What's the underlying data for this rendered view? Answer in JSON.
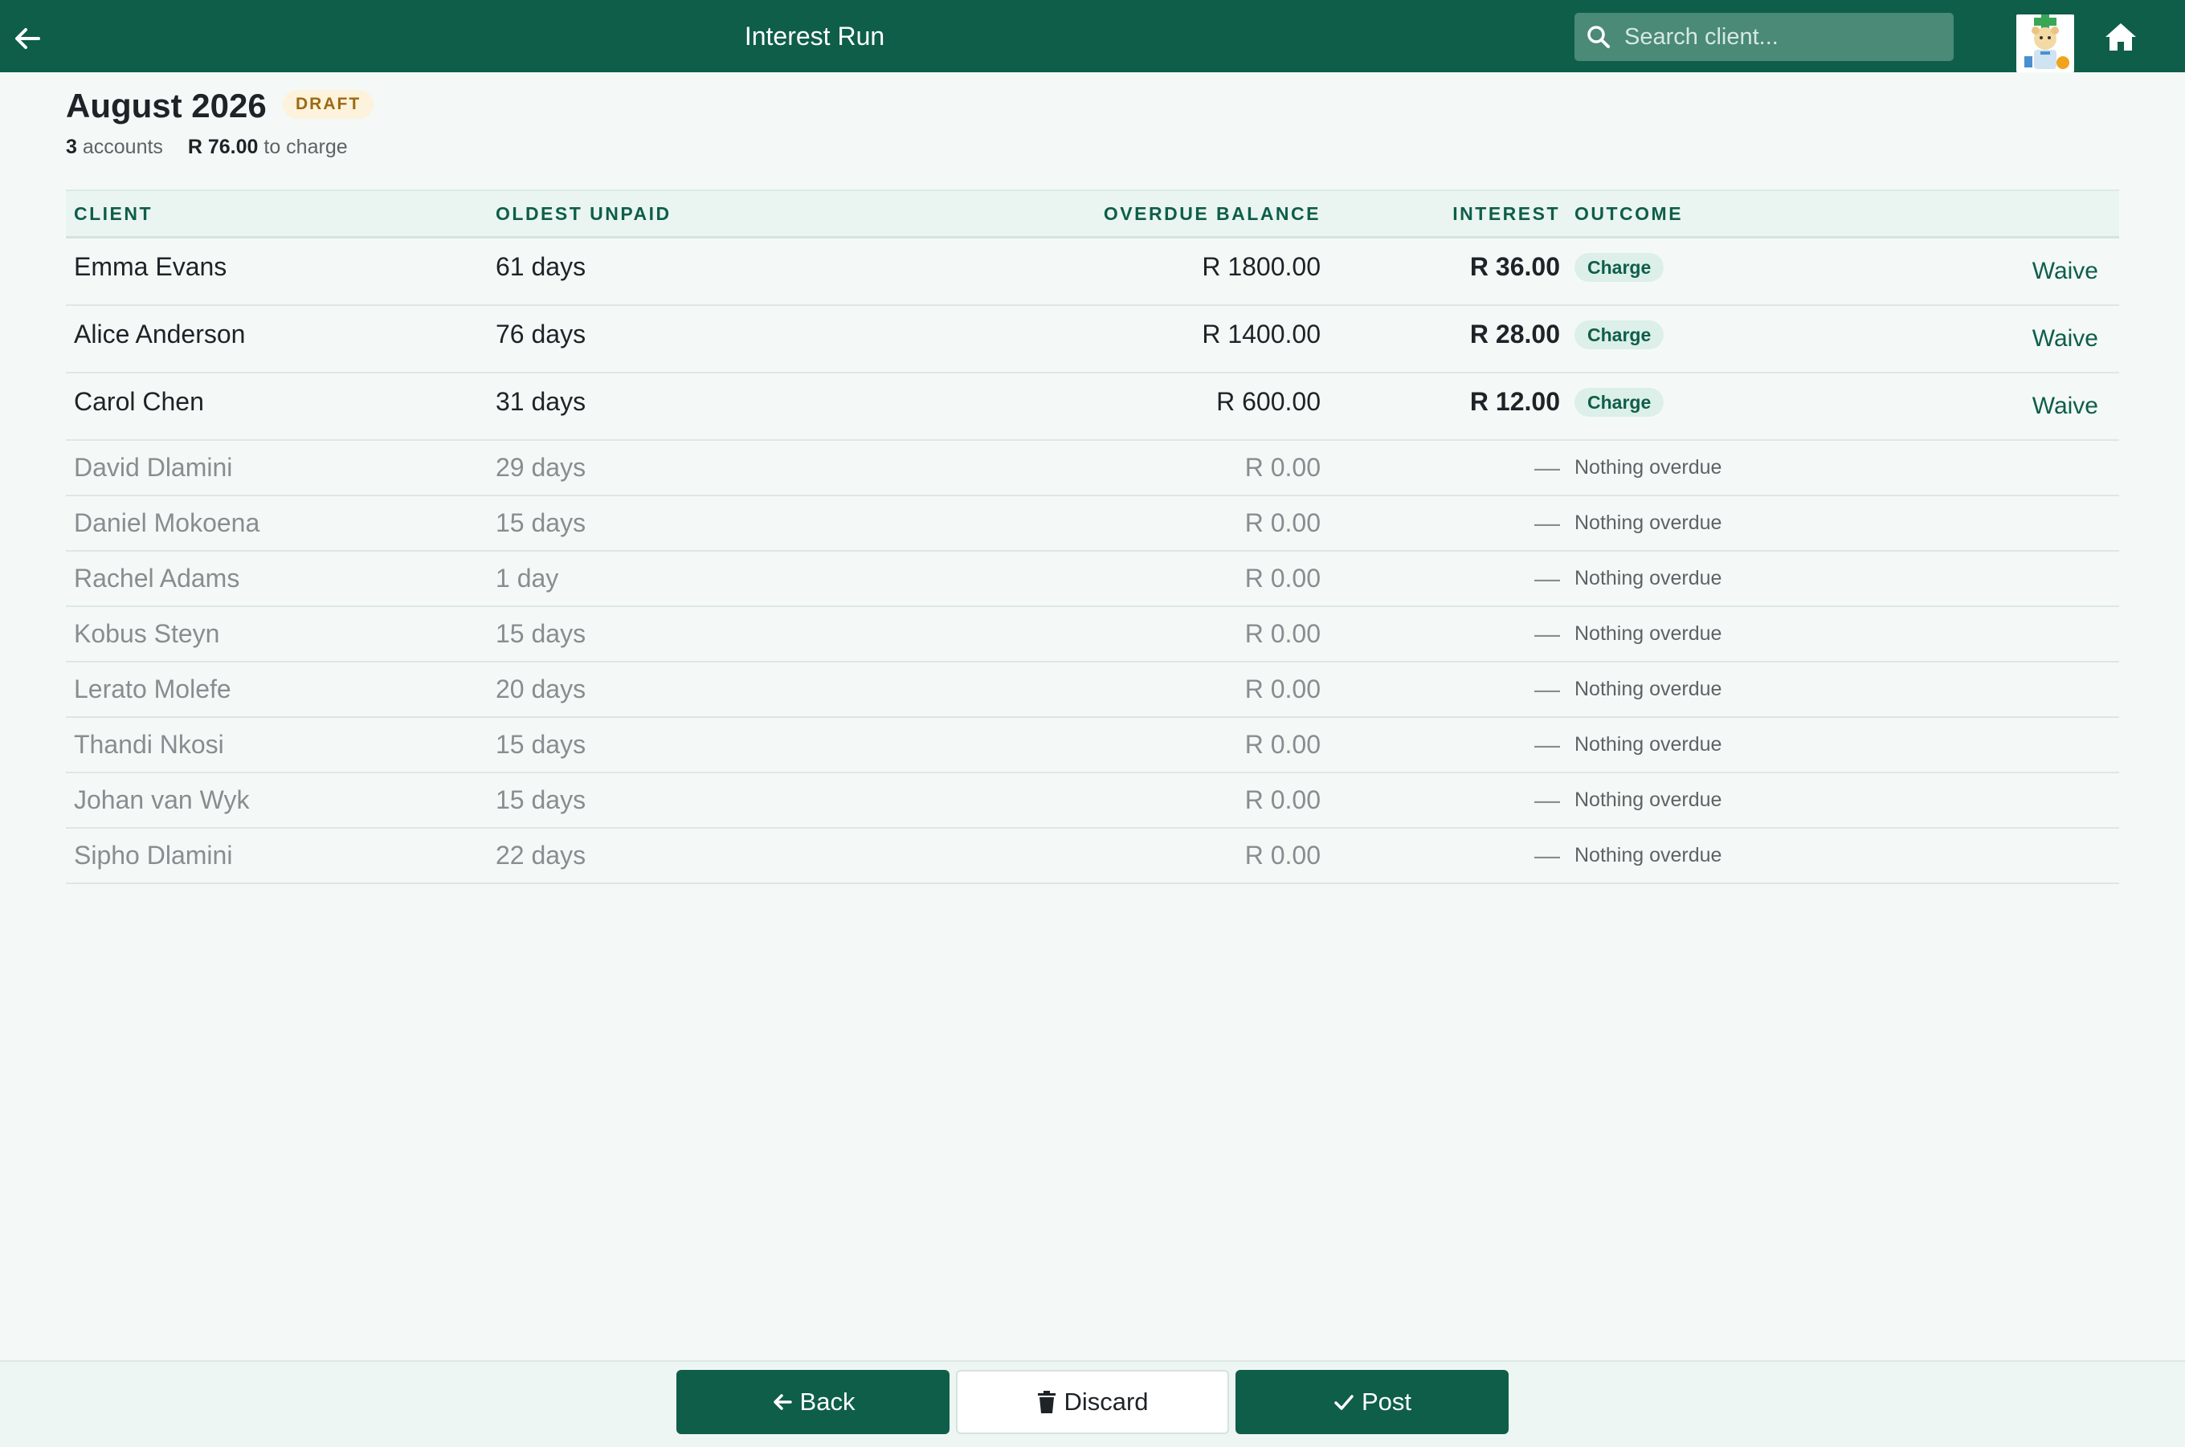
{
  "topbar": {
    "title": "Interest Run",
    "search_placeholder": "Search client..."
  },
  "header": {
    "title": "August 2026",
    "status_badge": "DRAFT",
    "account_count": "3",
    "accounts_label": "accounts",
    "total_charge": "R 76.00",
    "charge_label": "to charge"
  },
  "table": {
    "headers": {
      "client": "CLIENT",
      "oldest_unpaid": "OLDEST UNPAID",
      "overdue_balance": "OVERDUE BALANCE",
      "interest": "INTEREST",
      "outcome": "OUTCOME"
    },
    "charge_rows": [
      {
        "client": "Emma Evans",
        "oldest_unpaid": "61 days",
        "overdue_balance": "R 1800.00",
        "interest": "R 36.00",
        "outcome": "Charge",
        "action": "Waive"
      },
      {
        "client": "Alice Anderson",
        "oldest_unpaid": "76 days",
        "overdue_balance": "R 1400.00",
        "interest": "R 28.00",
        "outcome": "Charge",
        "action": "Waive"
      },
      {
        "client": "Carol Chen",
        "oldest_unpaid": "31 days",
        "overdue_balance": "R 600.00",
        "interest": "R 12.00",
        "outcome": "Charge",
        "action": "Waive"
      }
    ],
    "no_charge_rows": [
      {
        "client": "David Dlamini",
        "oldest_unpaid": "29 days",
        "overdue_balance": "R 0.00",
        "interest": "—",
        "outcome": "Nothing overdue"
      },
      {
        "client": "Daniel Mokoena",
        "oldest_unpaid": "15 days",
        "overdue_balance": "R 0.00",
        "interest": "—",
        "outcome": "Nothing overdue"
      },
      {
        "client": "Rachel Adams",
        "oldest_unpaid": "1 day",
        "overdue_balance": "R 0.00",
        "interest": "—",
        "outcome": "Nothing overdue"
      },
      {
        "client": "Kobus Steyn",
        "oldest_unpaid": "15 days",
        "overdue_balance": "R 0.00",
        "interest": "—",
        "outcome": "Nothing overdue"
      },
      {
        "client": "Lerato Molefe",
        "oldest_unpaid": "20 days",
        "overdue_balance": "R 0.00",
        "interest": "—",
        "outcome": "Nothing overdue"
      },
      {
        "client": "Thandi Nkosi",
        "oldest_unpaid": "15 days",
        "overdue_balance": "R 0.00",
        "interest": "—",
        "outcome": "Nothing overdue"
      },
      {
        "client": "Johan van Wyk",
        "oldest_unpaid": "15 days",
        "overdue_balance": "R 0.00",
        "interest": "—",
        "outcome": "Nothing overdue"
      },
      {
        "client": "Sipho Dlamini",
        "oldest_unpaid": "22 days",
        "overdue_balance": "R 0.00",
        "interest": "—",
        "outcome": "Nothing overdue"
      }
    ]
  },
  "footer": {
    "back_label": "Back",
    "discard_label": "Discard",
    "post_label": "Post"
  },
  "icons": {
    "back": "arrow-left-icon",
    "search": "search-icon",
    "home": "home-icon",
    "discard": "trash-icon",
    "post": "check-icon"
  },
  "colors": {
    "brand": "#0e5e49",
    "background": "#f4f9f7",
    "draft_badge_bg": "#fdf2dc",
    "draft_badge_text": "#9c6a14",
    "charge_badge_bg": "#dcefe8"
  }
}
